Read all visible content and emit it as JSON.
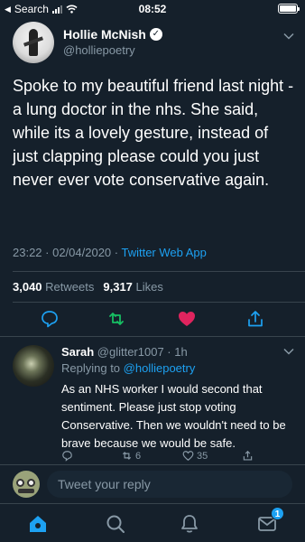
{
  "status_bar": {
    "back_label": "Search",
    "time": "08:52"
  },
  "tweet": {
    "author_name": "Hollie McNish",
    "author_handle": "@holliepoetry",
    "text": "Spoke to my beautiful friend last night - a lung doctor in the nhs. She said, while its a lovely gesture, instead of just clapping please could you just never ever vote conservative again.",
    "timestamp": "23:22 · 02/04/2020 · ",
    "source_app": "Twitter Web App",
    "retweets_count": "3,040",
    "retweets_label": "Retweets",
    "likes_count": "9,317",
    "likes_label": "Likes",
    "like_color": "#e0245e"
  },
  "reply": {
    "name": "Sarah",
    "handle_time": "@glitter1007 · 1h",
    "replying_prefix": "Replying to",
    "replying_to": "@holliepoetry",
    "text": "As an NHS worker I would second that sentiment. Please just stop voting Conservative. Then we wouldn't need to be brave because we would be safe.",
    "retweet_count": "6",
    "like_count": "35"
  },
  "compose": {
    "placeholder": "Tweet your reply"
  },
  "bottom_nav": {
    "messages_badge": "1",
    "accent_color": "#1da1f2"
  }
}
